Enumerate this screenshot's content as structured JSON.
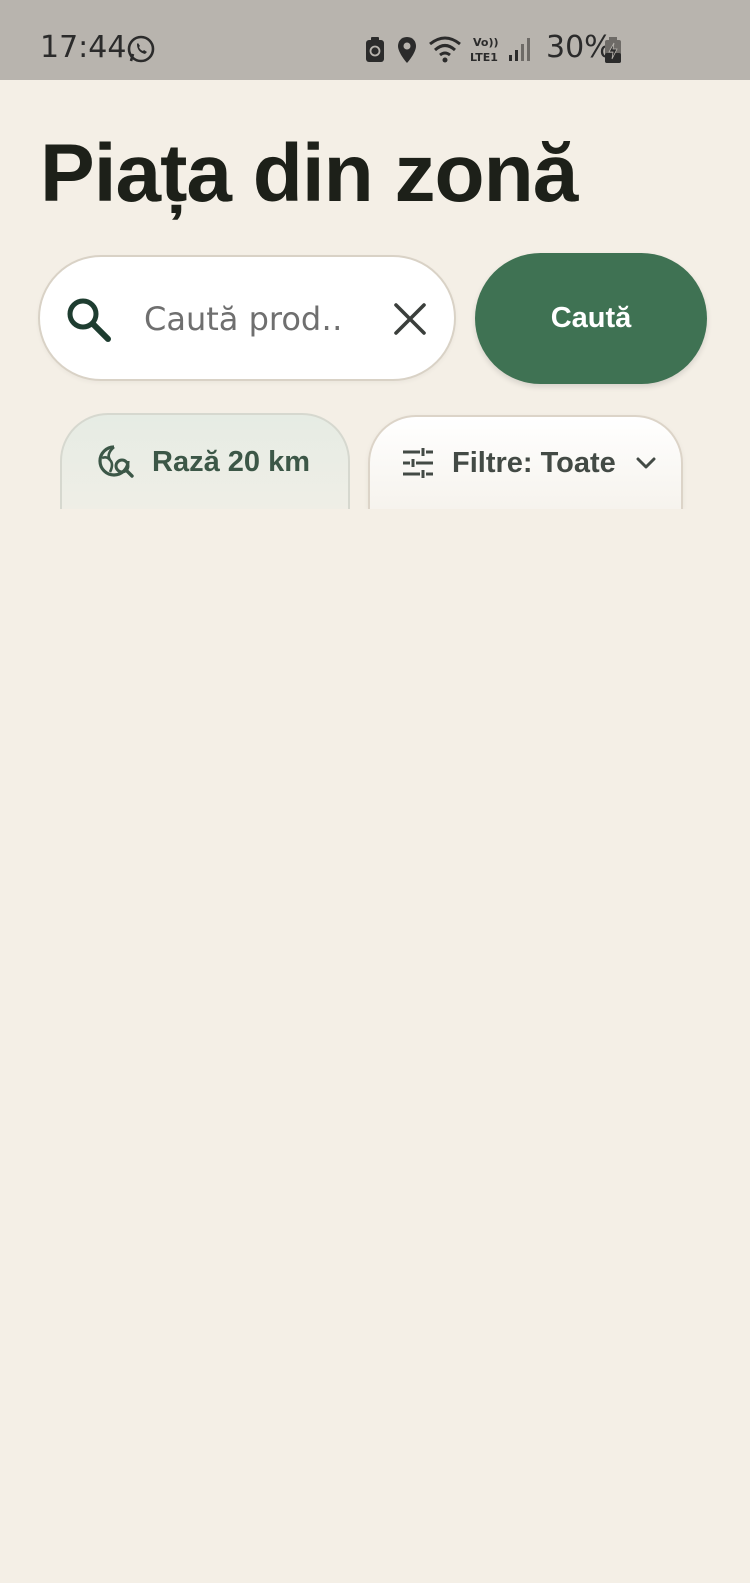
{
  "status_bar": {
    "time": "17:44",
    "battery": "30%",
    "icons": [
      "whatsapp-icon",
      "battery-saver-icon",
      "location-icon",
      "wifi-icon",
      "volte-lte-icon",
      "signal-icon",
      "battery-charging-icon"
    ]
  },
  "header": {
    "title": "Piața din zonă"
  },
  "search": {
    "placeholder": "Caută prod…",
    "value": "",
    "button_label": "Caută"
  },
  "chips": {
    "radius_label": "Rază 20 km",
    "filters_label": "Filtre: Toate"
  },
  "colors": {
    "background": "#f4efe6",
    "status_bar": "#b8b4ae",
    "accent": "#3f7253",
    "title": "#1d2019"
  }
}
